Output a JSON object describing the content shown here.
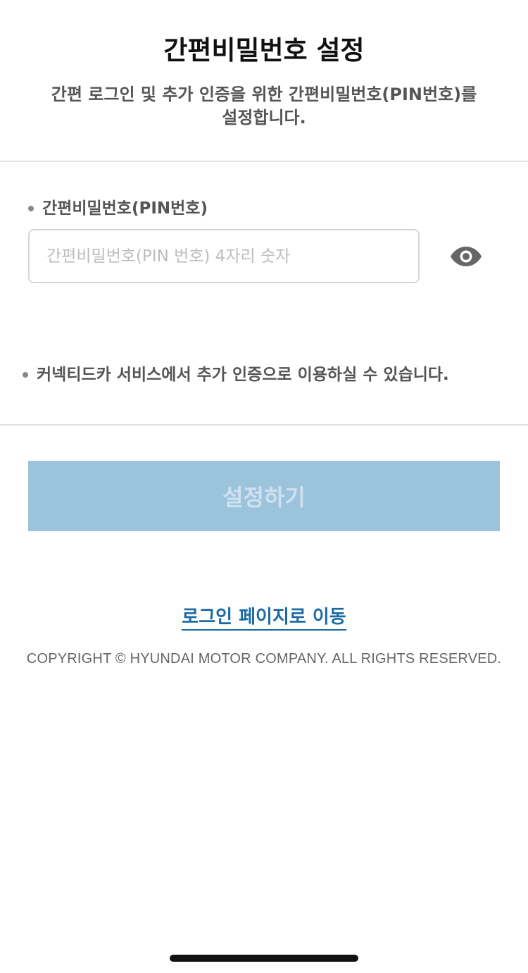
{
  "header": {
    "title": "간편비밀번호 설정",
    "subtitle_line1": "간편 로그인 및 추가 인증을 위한 간편비밀번호(PIN번호)를",
    "subtitle_line2": "설정합니다."
  },
  "form": {
    "pin_label": "간편비밀번호(PIN번호)",
    "pin_value": "",
    "pin_placeholder": "간편비밀번호(PIN 번호) 4자리 숫자",
    "toggle_icon": "eye-icon",
    "notice": "커넥티드카 서비스에서 추가 인증으로 이용하실 수 있습니다.",
    "submit_label": "설정하기"
  },
  "footer": {
    "login_link": "로그인 페이지로 이동",
    "copyright": "COPYRIGHT © HYUNDAI MOTOR COMPANY. ALL RIGHTS RESERVED."
  },
  "colors": {
    "button_disabled": "#9cc3dc",
    "link": "#1a6ba3"
  }
}
